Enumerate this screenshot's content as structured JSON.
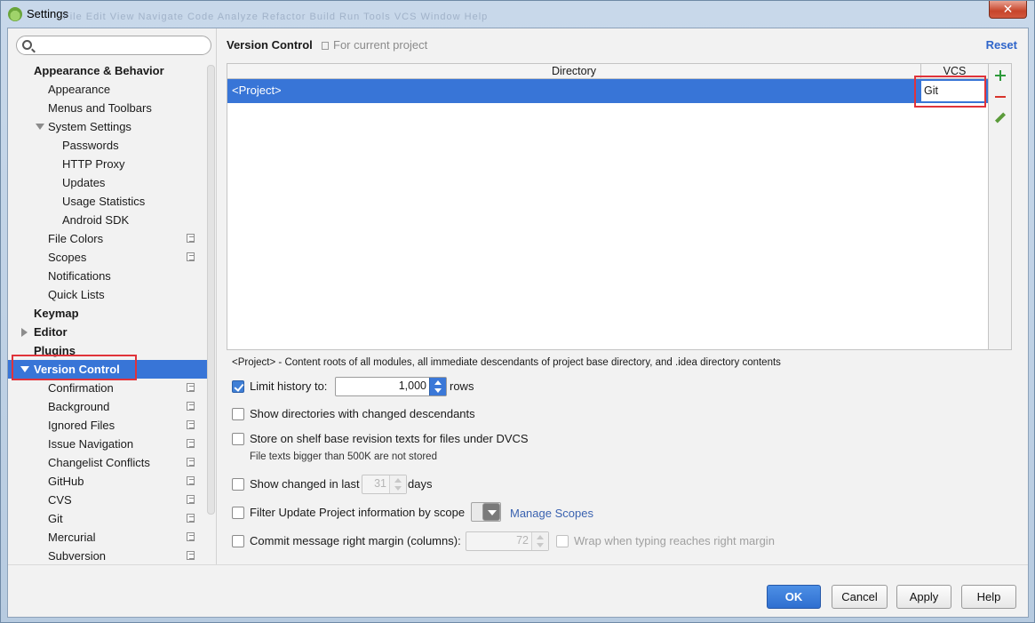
{
  "window": {
    "title": "Settings",
    "background_menu": "File  Edit  View  Navigate  Code  Analyze  Refactor  Build  Run  Tools  VCS  Window  Help",
    "close_glyph": "✕"
  },
  "search": {
    "value": "",
    "placeholder": ""
  },
  "sidebar": {
    "appearance_behavior": "Appearance & Behavior",
    "appearance": "Appearance",
    "menus_toolbars": "Menus and Toolbars",
    "system_settings": "System Settings",
    "passwords": "Passwords",
    "http_proxy": "HTTP Proxy",
    "updates": "Updates",
    "usage_statistics": "Usage Statistics",
    "android_sdk": "Android SDK",
    "file_colors": "File Colors",
    "scopes": "Scopes",
    "notifications": "Notifications",
    "quick_lists": "Quick Lists",
    "keymap": "Keymap",
    "editor": "Editor",
    "plugins": "Plugins",
    "version_control": "Version Control",
    "vc_children": [
      "Confirmation",
      "Background",
      "Ignored Files",
      "Issue Navigation",
      "Changelist Conflicts",
      "GitHub",
      "CVS",
      "Git",
      "Mercurial",
      "Subversion"
    ]
  },
  "header": {
    "title": "Version Control",
    "scope": "For current project",
    "reset": "Reset"
  },
  "table": {
    "columns": [
      "Directory",
      "VCS"
    ],
    "rows": [
      {
        "directory": "<Project>",
        "vcs": "Git"
      }
    ]
  },
  "description": "<Project> - Content roots of all modules, all immediate descendants of project base directory, and .idea directory contents",
  "options": {
    "limit_history": {
      "label": "Limit history to:",
      "checked": true,
      "value": "1,000",
      "suffix": "rows"
    },
    "show_dirs_changed": {
      "label": "Show directories with changed descendants",
      "checked": false
    },
    "store_on_shelf": {
      "label": "Store on shelf base revision texts for files under DVCS",
      "checked": false,
      "note": "File texts bigger than 500K are not stored"
    },
    "show_changed_last": {
      "label": "Show changed in last",
      "checked": false,
      "value": "31",
      "suffix": "days"
    },
    "filter_update": {
      "label": "Filter Update Project information by scope",
      "checked": false,
      "link": "Manage Scopes"
    },
    "commit_margin": {
      "label": "Commit message right margin (columns):",
      "checked": false,
      "value": "72",
      "wrap_label": "Wrap when typing reaches right margin"
    }
  },
  "footer": {
    "ok": "OK",
    "cancel": "Cancel",
    "apply": "Apply",
    "help": "Help"
  },
  "colors": {
    "selection": "#3875d7",
    "highlight": "#e0333a",
    "link": "#3a62b0",
    "accent": "#2f65ca"
  }
}
